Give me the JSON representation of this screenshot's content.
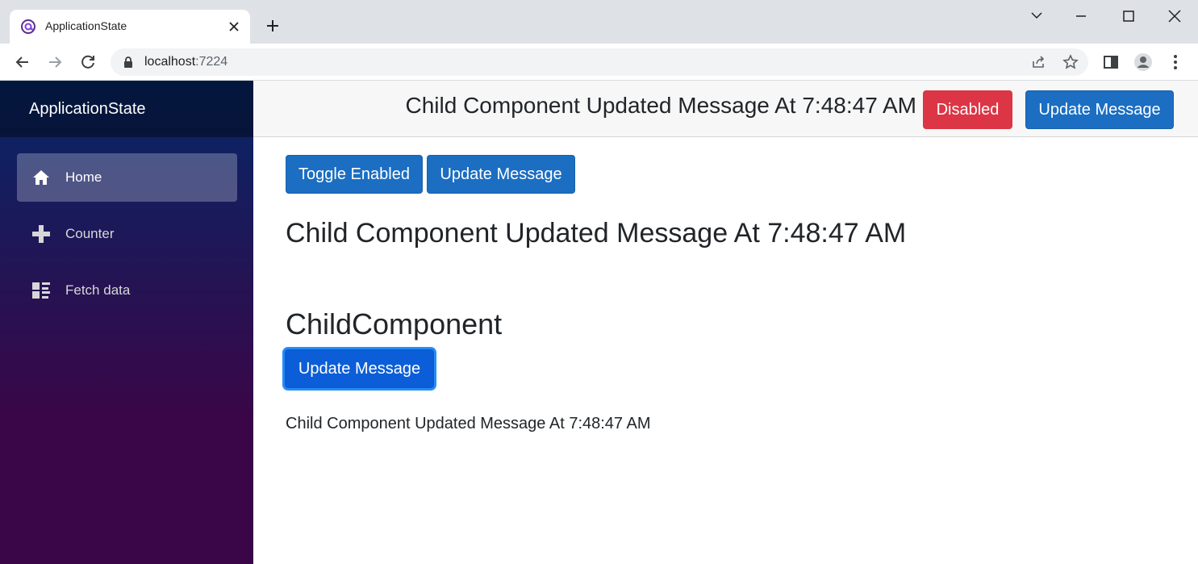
{
  "browser": {
    "tab_title": "ApplicationState",
    "url_host": "localhost",
    "url_port": ":7224"
  },
  "sidebar": {
    "brand": "ApplicationState",
    "items": [
      {
        "label": "Home",
        "icon": "home-icon",
        "active": true
      },
      {
        "label": "Counter",
        "icon": "plus-icon",
        "active": false
      },
      {
        "label": "Fetch data",
        "icon": "list-rich-icon",
        "active": false
      }
    ]
  },
  "topbar": {
    "message": "Child Component Updated Message At 7:48:47 AM",
    "disabled_label": "Disabled",
    "update_label": "Update Message"
  },
  "main": {
    "toggle_label": "Toggle Enabled",
    "update_label": "Update Message",
    "message_heading": "Child Component Updated Message At 7:48:47 AM",
    "child_heading": "ChildComponent",
    "child_update_label": "Update Message",
    "child_message": "Child Component Updated Message At 7:48:47 AM"
  },
  "colors": {
    "primary": "#1b6ec2",
    "danger": "#dc3545",
    "sidebar_top": "#052767",
    "sidebar_bottom": "#3a0647"
  }
}
